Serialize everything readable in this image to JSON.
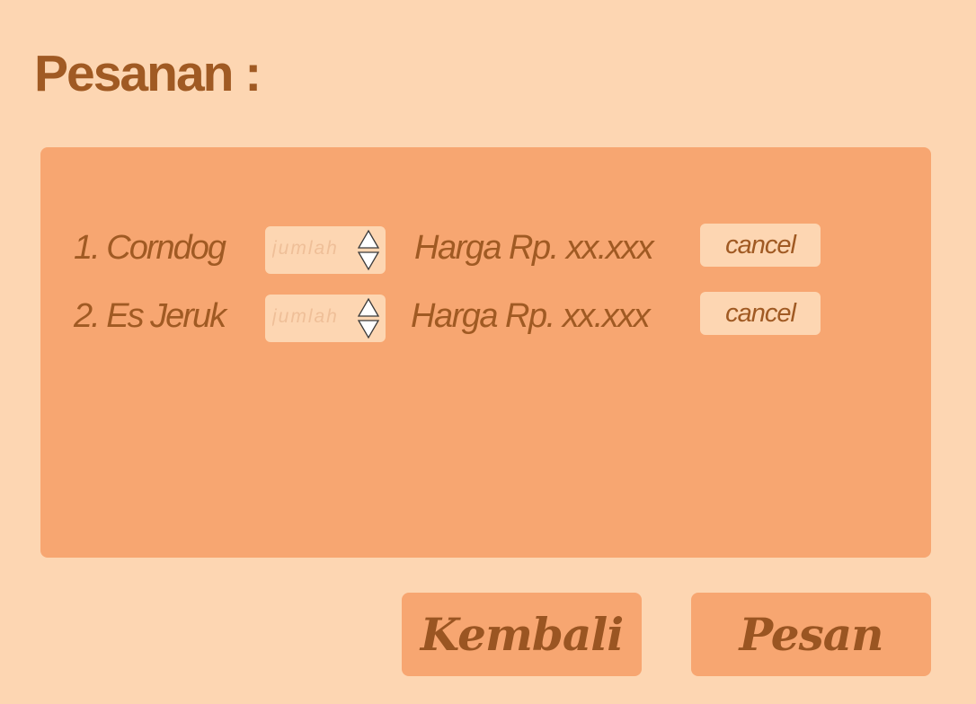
{
  "page": {
    "title": "Pesanan :"
  },
  "order": {
    "items": [
      {
        "name": "1. Corndog",
        "quantity_placeholder": "jumlah",
        "price": "Harga Rp. xx.xxx",
        "cancel_label": "cancel"
      },
      {
        "name": "2. Es Jeruk",
        "quantity_placeholder": "jumlah",
        "price": "Harga Rp. xx.xxx",
        "cancel_label": "cancel"
      }
    ]
  },
  "actions": {
    "back_label": "Kembali",
    "order_label": "Pesan"
  },
  "icons": {
    "increment": "triangle-up-icon",
    "decrement": "triangle-down-icon"
  },
  "colors": {
    "background": "#fdd6b2",
    "panel": "#f7a671",
    "text": "#a05a23",
    "placeholder": "#efbf98"
  }
}
